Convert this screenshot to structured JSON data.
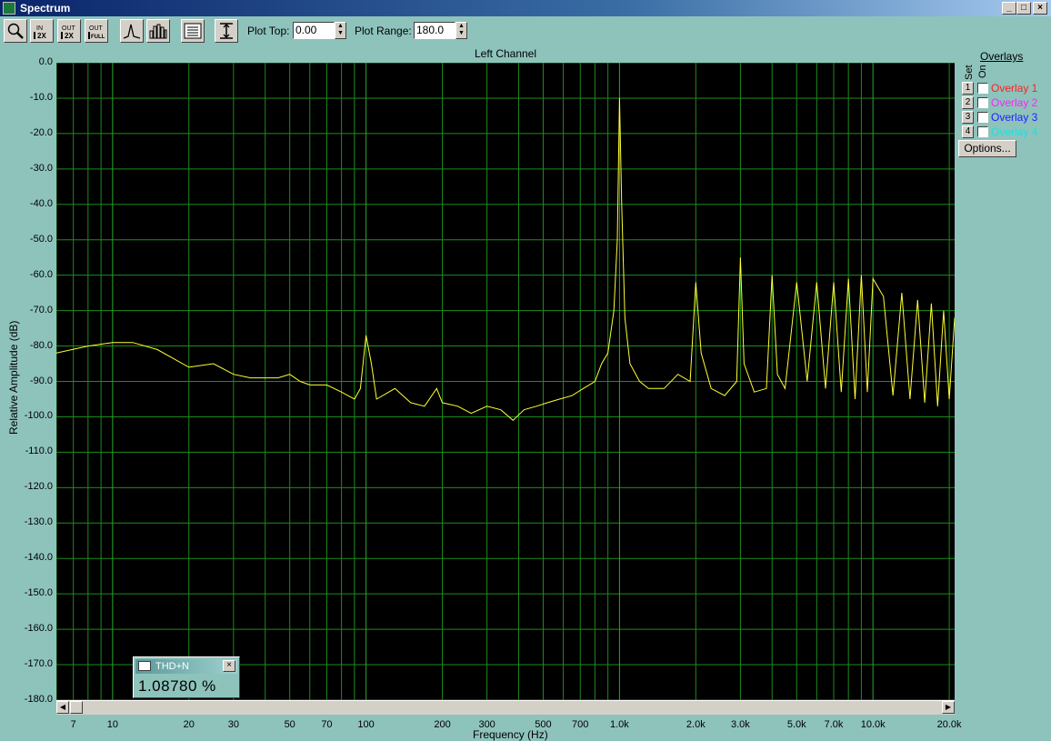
{
  "window": {
    "title": "Spectrum",
    "buttons": {
      "minimize": "_",
      "maximize": "□",
      "close": "×"
    }
  },
  "toolbar": {
    "icons": [
      "zoom-icon",
      "zoom-in-2x-icon",
      "zoom-out-2x-icon",
      "zoom-out-full-icon",
      "line-mode-icon",
      "bar-mode-icon",
      "settings-list-icon",
      "plot-range-icon"
    ],
    "zoom_in_2x": {
      "top": "IN",
      "bottom": "2X"
    },
    "zoom_out_2x": {
      "top": "OUT",
      "bottom": "2X"
    },
    "zoom_out_full": {
      "top": "OUT",
      "bottom": "FULL"
    },
    "plot_top_label": "Plot Top:",
    "plot_top_value": "0.00",
    "plot_range_label": "Plot Range:",
    "plot_range_value": "180.0"
  },
  "overlays": {
    "title": "Overlays",
    "set_label": "Set",
    "on_label": "On",
    "items": [
      {
        "num": "1",
        "label": "Overlay 1",
        "color": "#ff2020"
      },
      {
        "num": "2",
        "label": "Overlay 2",
        "color": "#ff20ff"
      },
      {
        "num": "3",
        "label": "Overlay 3",
        "color": "#2020ff"
      },
      {
        "num": "4",
        "label": "Overlay 4",
        "color": "#20e0e0"
      }
    ],
    "options_label": "Options..."
  },
  "thd": {
    "label": "THD+N",
    "value": "1.08780 %"
  },
  "chart_data": {
    "type": "line",
    "title": "Left Channel",
    "xlabel": "Frequency (Hz)",
    "ylabel": "Relative Amplitude (dB)",
    "x_scale": "log",
    "xlim": [
      6,
      21000
    ],
    "ylim": [
      -180,
      0
    ],
    "grid": true,
    "yticks": [
      "0.0",
      "-10.0",
      "-20.0",
      "-30.0",
      "-40.0",
      "-50.0",
      "-60.0",
      "-70.0",
      "-80.0",
      "-90.0",
      "-100.0",
      "-110.0",
      "-120.0",
      "-130.0",
      "-140.0",
      "-150.0",
      "-160.0",
      "-170.0",
      "-180.0"
    ],
    "xticks": [
      {
        "v": 7,
        "label": "7"
      },
      {
        "v": 10,
        "label": "10"
      },
      {
        "v": 20,
        "label": "20"
      },
      {
        "v": 30,
        "label": "30"
      },
      {
        "v": 50,
        "label": "50"
      },
      {
        "v": 70,
        "label": "70"
      },
      {
        "v": 100,
        "label": "100"
      },
      {
        "v": 200,
        "label": "200"
      },
      {
        "v": 300,
        "label": "300"
      },
      {
        "v": 500,
        "label": "500"
      },
      {
        "v": 700,
        "label": "700"
      },
      {
        "v": 1000,
        "label": "1.0k"
      },
      {
        "v": 2000,
        "label": "2.0k"
      },
      {
        "v": 3000,
        "label": "3.0k"
      },
      {
        "v": 5000,
        "label": "5.0k"
      },
      {
        "v": 7000,
        "label": "7.0k"
      },
      {
        "v": 10000,
        "label": "10.0k"
      },
      {
        "v": 20000,
        "label": "20.0k"
      }
    ],
    "series": [
      {
        "color": "#ffff33",
        "x": [
          6,
          8,
          10,
          12,
          15,
          20,
          25,
          30,
          35,
          40,
          45,
          50,
          55,
          60,
          70,
          80,
          90,
          95,
          100,
          105,
          110,
          130,
          150,
          170,
          190,
          200,
          230,
          260,
          300,
          340,
          380,
          420,
          470,
          520,
          580,
          650,
          720,
          800,
          850,
          900,
          950,
          980,
          1000,
          1020,
          1050,
          1100,
          1200,
          1300,
          1500,
          1700,
          1900,
          2000,
          2100,
          2300,
          2600,
          2900,
          3000,
          3100,
          3400,
          3800,
          4000,
          4200,
          4500,
          5000,
          5500,
          6000,
          6500,
          7000,
          7500,
          8000,
          8500,
          9000,
          9500,
          10000,
          11000,
          12000,
          13000,
          14000,
          15000,
          16000,
          17000,
          18000,
          19000,
          20000,
          21000
        ],
        "y": [
          -82,
          -80,
          -79,
          -79,
          -81,
          -86,
          -85,
          -88,
          -89,
          -89,
          -89,
          -88,
          -90,
          -91,
          -91,
          -93,
          -95,
          -92,
          -77,
          -85,
          -95,
          -92,
          -96,
          -97,
          -92,
          -96,
          -97,
          -99,
          -97,
          -98,
          -101,
          -98,
          -97,
          -96,
          -95,
          -94,
          -92,
          -90,
          -85,
          -82,
          -70,
          -50,
          -10,
          -40,
          -72,
          -85,
          -90,
          -92,
          -92,
          -88,
          -90,
          -62,
          -82,
          -92,
          -94,
          -90,
          -55,
          -85,
          -93,
          -92,
          -60,
          -88,
          -92,
          -62,
          -90,
          -62,
          -92,
          -62,
          -93,
          -61,
          -95,
          -60,
          -93,
          -61,
          -66,
          -94,
          -65,
          -95,
          -67,
          -96,
          -68,
          -97,
          -70,
          -95,
          -72
        ]
      }
    ]
  }
}
